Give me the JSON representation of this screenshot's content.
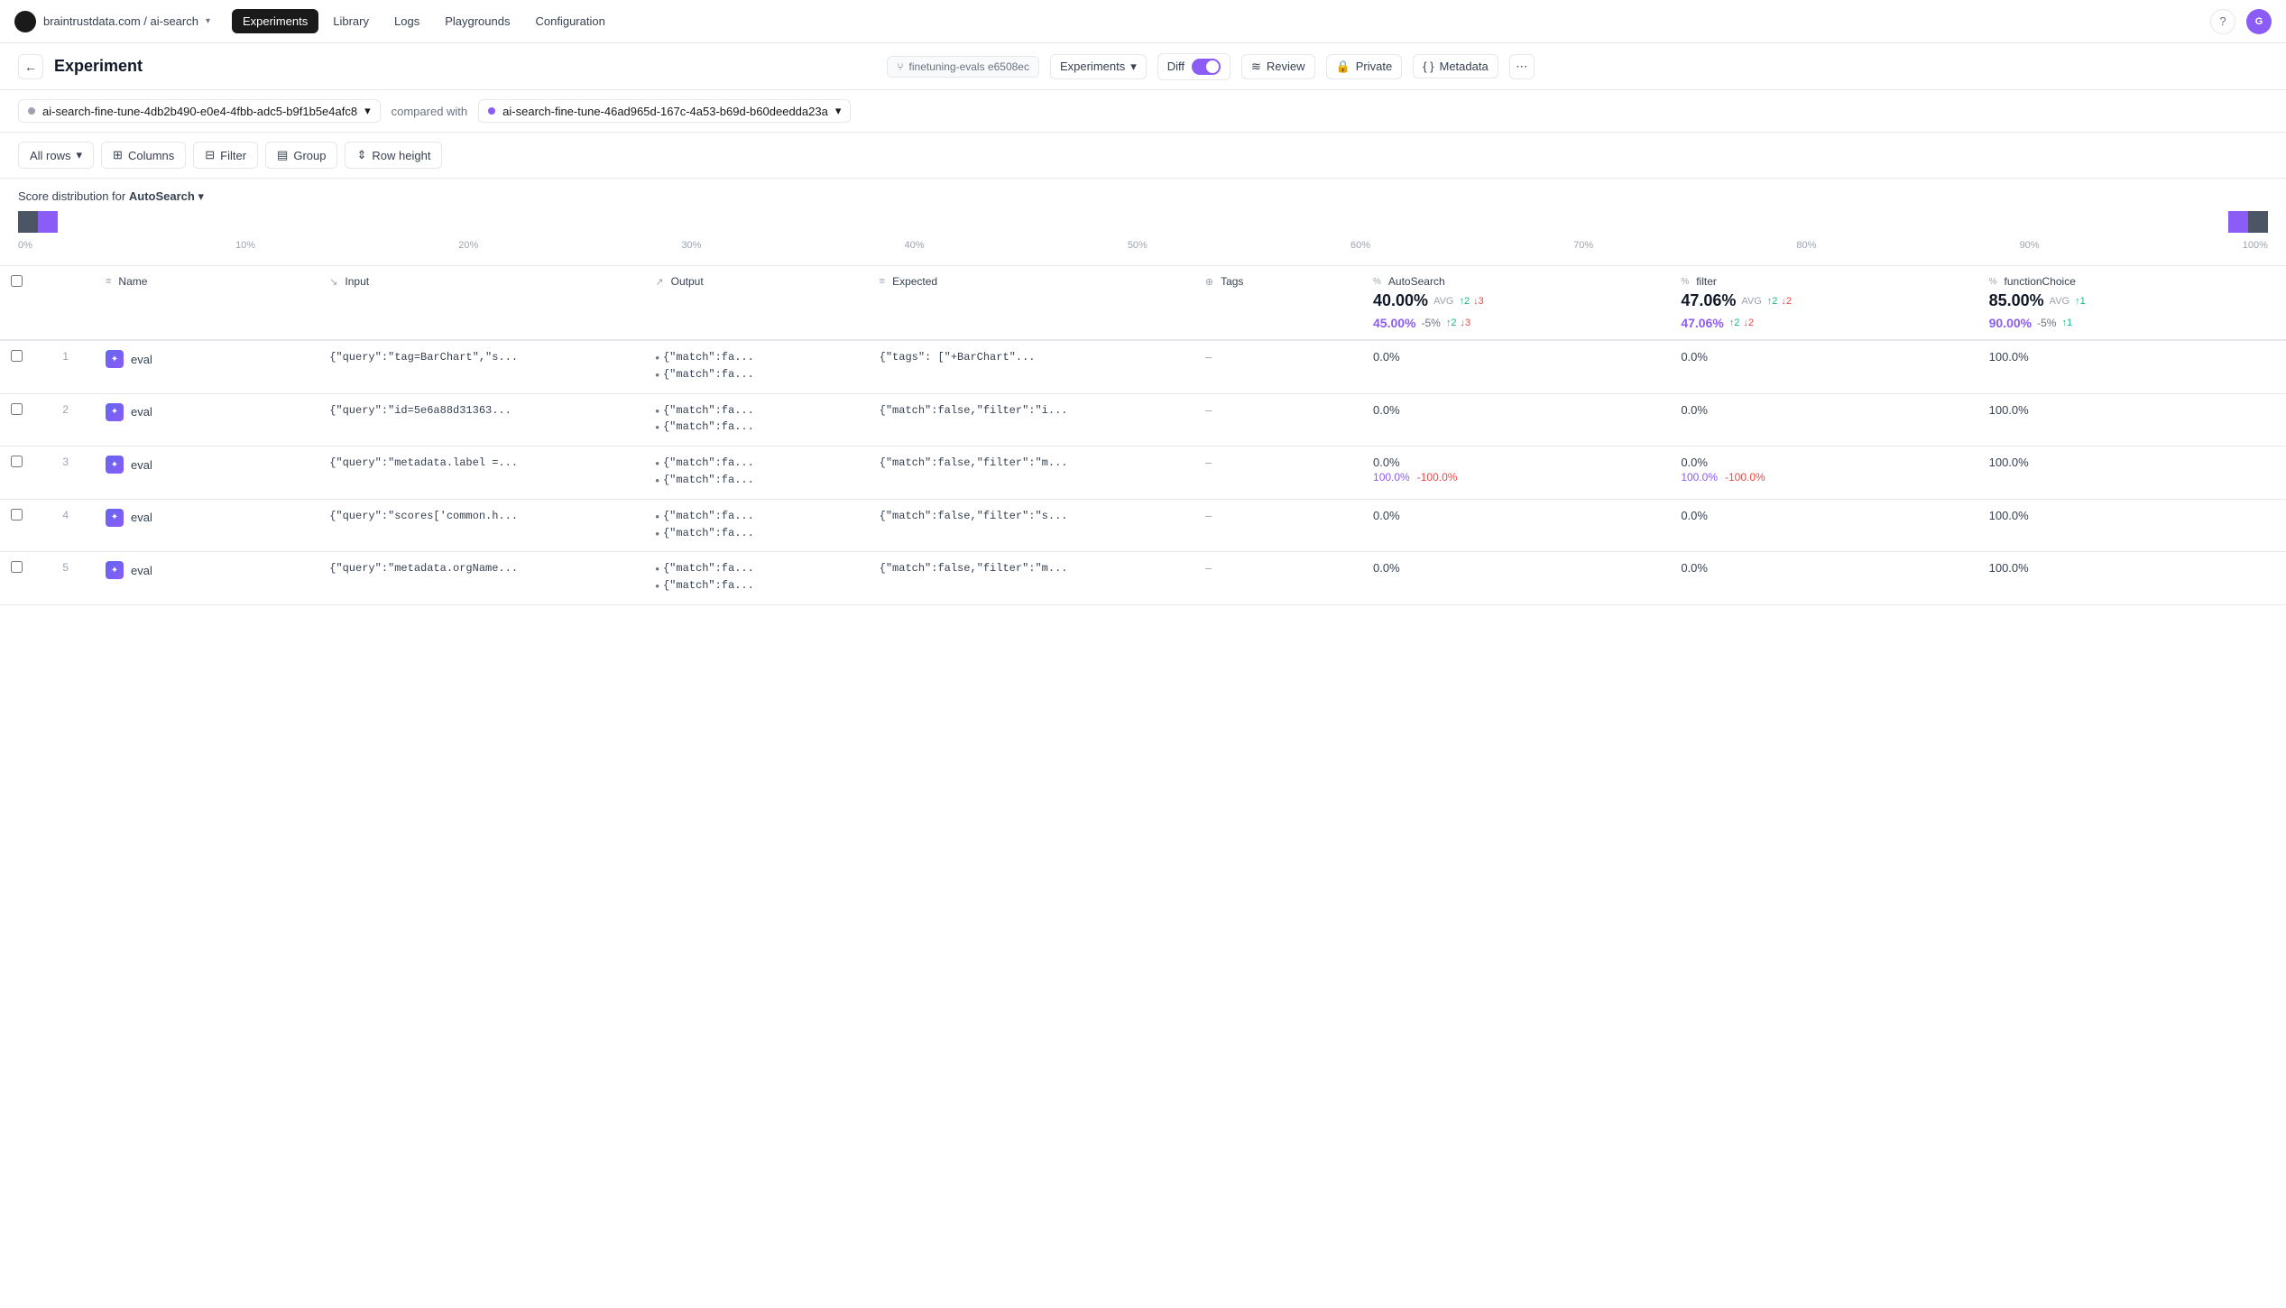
{
  "nav": {
    "brand": "braintrustdata.com / ai-search",
    "items": [
      "Experiments",
      "Library",
      "Logs",
      "Playgrounds",
      "Configuration"
    ],
    "active_item": "Experiments",
    "help_icon": "?",
    "avatar_label": "G"
  },
  "sub_header": {
    "title": "Experiment",
    "branch_label": "finetuning-evals e6508ec",
    "experiments_btn": "Experiments",
    "diff_label": "Diff",
    "review_btn": "Review",
    "private_btn": "Private",
    "metadata_btn": "Metadata"
  },
  "experiment_selector": {
    "exp1": "ai-search-fine-tune-4db2b490-e0e4-4fbb-adc5-b9f1b5e4afc8",
    "compared_label": "compared with",
    "exp2": "ai-search-fine-tune-46ad965d-167c-4a53-b69d-b60deedda23a"
  },
  "toolbar": {
    "all_rows_btn": "All rows",
    "columns_btn": "Columns",
    "filter_btn": "Filter",
    "group_btn": "Group",
    "row_height_btn": "Row height"
  },
  "score_dist": {
    "label_prefix": "Score distribution for",
    "label_name": "AutoSearch"
  },
  "dist_scale": [
    "0%",
    "10%",
    "20%",
    "30%",
    "40%",
    "50%",
    "60%",
    "70%",
    "80%",
    "90%",
    "100%"
  ],
  "columns": [
    {
      "label": "Name",
      "icon": "≡"
    },
    {
      "label": "Input",
      "icon": "↘"
    },
    {
      "label": "Output",
      "icon": "↗"
    },
    {
      "label": "Expected",
      "icon": "≡"
    },
    {
      "label": "Tags",
      "icon": "⊕"
    },
    {
      "label": "AutoSearch",
      "icon": "%"
    },
    {
      "label": "filter",
      "icon": "%"
    },
    {
      "label": "functionChoice",
      "icon": "%"
    }
  ],
  "autosearch_avg": "40.00%",
  "autosearch_avg_label": "AVG",
  "autosearch_up": "↑2",
  "autosearch_down": "↓3",
  "autosearch_compare": "45.00%",
  "autosearch_compare_diff": "-5%",
  "autosearch_compare_up": "↑2",
  "autosearch_compare_down": "↓3",
  "filter_avg": "47.06%",
  "filter_avg_label": "AVG",
  "filter_up": "↑2",
  "filter_down": "↓2",
  "filter_compare": "47.06%",
  "filter_compare_up": "↑2",
  "filter_compare_down": "↓2",
  "functionchoice_avg": "85.00%",
  "functionchoice_avg_label": "AVG",
  "functionchoice_up": "↑1",
  "functionchoice_compare": "90.00%",
  "functionchoice_compare_diff": "-5%",
  "functionchoice_compare_up": "↑1",
  "rows": [
    {
      "num": "1",
      "name": "eval",
      "input": "{\"query\":\"tag=BarChart\",\"s...",
      "output1": "{\"match\":fa...",
      "output2": "{\"match\":fa...",
      "expected": "{\"tags\": [\"+BarChart\"...",
      "tags": "–",
      "autosearch": "0.0%",
      "autosearch_compare": "",
      "filter": "0.0%",
      "filter_compare": "",
      "functionchoice": "100.0%",
      "functionchoice_compare": ""
    },
    {
      "num": "2",
      "name": "eval",
      "input": "{\"query\":\"id=5e6a88d31363...",
      "output1": "{\"match\":fa...",
      "output2": "{\"match\":fa...",
      "expected": "{\"match\":false,\"filter\":\"i...",
      "tags": "–",
      "autosearch": "0.0%",
      "autosearch_compare": "",
      "filter": "0.0%",
      "filter_compare": "",
      "functionchoice": "100.0%",
      "functionchoice_compare": ""
    },
    {
      "num": "3",
      "name": "eval",
      "input": "{\"query\":\"metadata.label =...",
      "output1": "{\"match\":fa...",
      "output2": "{\"match\":fa...",
      "expected": "{\"match\":false,\"filter\":\"m...",
      "tags": "–",
      "autosearch": "0.0%",
      "autosearch_compare_val": "100.0%",
      "autosearch_compare_diff": "-100.0%",
      "filter": "0.0%",
      "filter_compare_val": "100.0%",
      "filter_compare_diff": "-100.0%",
      "functionchoice": "100.0%",
      "functionchoice_compare": ""
    },
    {
      "num": "4",
      "name": "eval",
      "input": "{\"query\":\"scores['common.h...",
      "output1": "{\"match\":fa...",
      "output2": "{\"match\":fa...",
      "expected": "{\"match\":false,\"filter\":\"s...",
      "tags": "–",
      "autosearch": "0.0%",
      "autosearch_compare": "",
      "filter": "0.0%",
      "filter_compare": "",
      "functionchoice": "100.0%",
      "functionchoice_compare": ""
    },
    {
      "num": "5",
      "name": "eval",
      "input": "{\"query\":\"metadata.orgName...",
      "output1": "{\"match\":fa...",
      "output2": "{\"match\":fa...",
      "expected": "{\"match\":false,\"filter\":\"m...",
      "tags": "–",
      "autosearch": "0.0%",
      "autosearch_compare": "",
      "filter": "0.0%",
      "filter_compare": "",
      "functionchoice": "100.0%",
      "functionchoice_compare": ""
    }
  ]
}
